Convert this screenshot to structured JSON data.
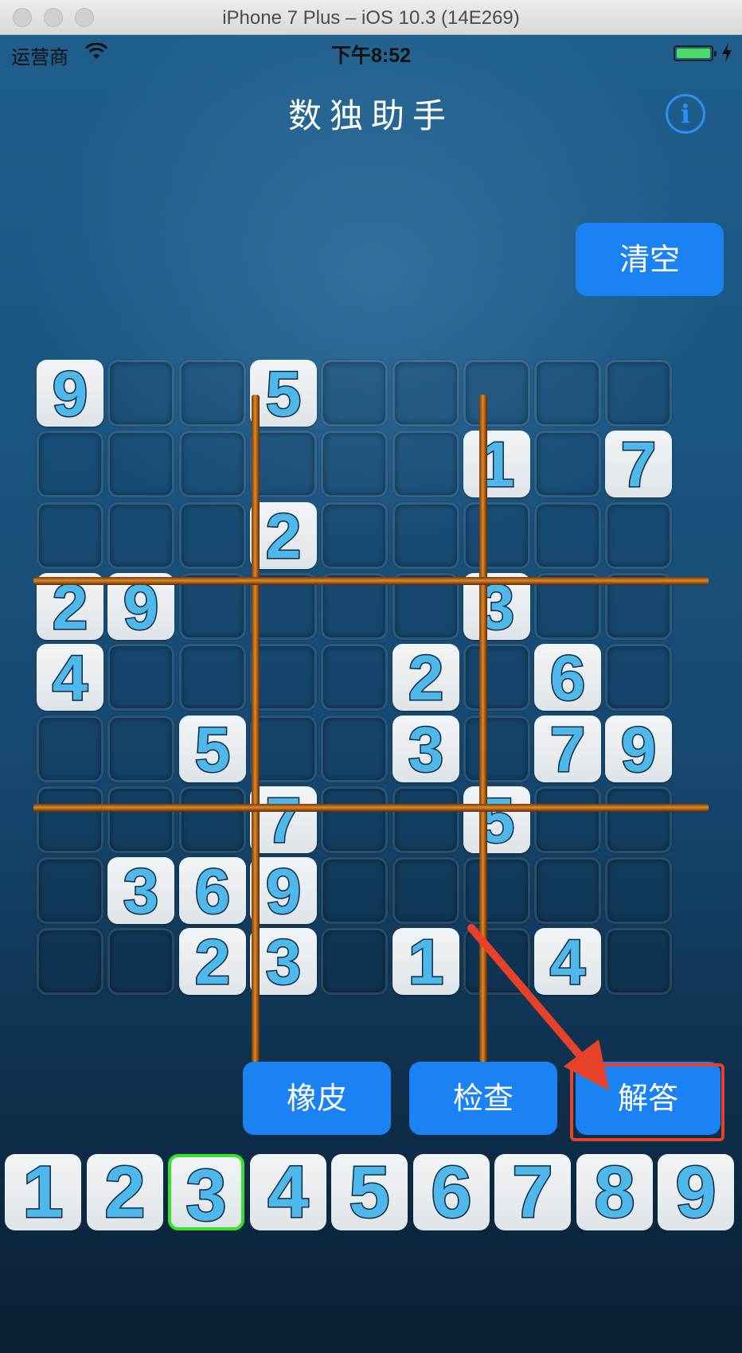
{
  "window": {
    "title": "iPhone 7 Plus – iOS 10.3 (14E269)"
  },
  "status_bar": {
    "carrier": "运营商",
    "time": "下午8:52"
  },
  "nav": {
    "title": "数独助手"
  },
  "buttons": {
    "clear": "清空",
    "eraser": "橡皮",
    "check": "检查",
    "solve": "解答",
    "info": "i"
  },
  "board": [
    [
      "9",
      "",
      "",
      "5",
      "",
      "",
      "",
      "",
      ""
    ],
    [
      "",
      "",
      "",
      "",
      "",
      "",
      "1",
      "",
      "7"
    ],
    [
      "",
      "",
      "",
      "2",
      "",
      "",
      "",
      "",
      ""
    ],
    [
      "2",
      "9",
      "",
      "",
      "",
      "",
      "3",
      "",
      ""
    ],
    [
      "4",
      "",
      "",
      "",
      "",
      "2",
      "",
      "6",
      ""
    ],
    [
      "",
      "",
      "5",
      "",
      "",
      "3",
      "",
      "7",
      "9"
    ],
    [
      "",
      "",
      "",
      "7",
      "",
      "",
      "5",
      "",
      ""
    ],
    [
      "",
      "3",
      "6",
      "9",
      "",
      "",
      "",
      "",
      ""
    ],
    [
      "",
      "",
      "2",
      "3",
      "",
      "1",
      "",
      "4",
      ""
    ]
  ],
  "number_pad": {
    "digits": [
      "1",
      "2",
      "3",
      "4",
      "5",
      "6",
      "7",
      "8",
      "9"
    ],
    "selected": "3"
  },
  "colors": {
    "accent": "#1a82f2",
    "selected_outline": "#35e02f",
    "annotation": "#e8412a"
  }
}
